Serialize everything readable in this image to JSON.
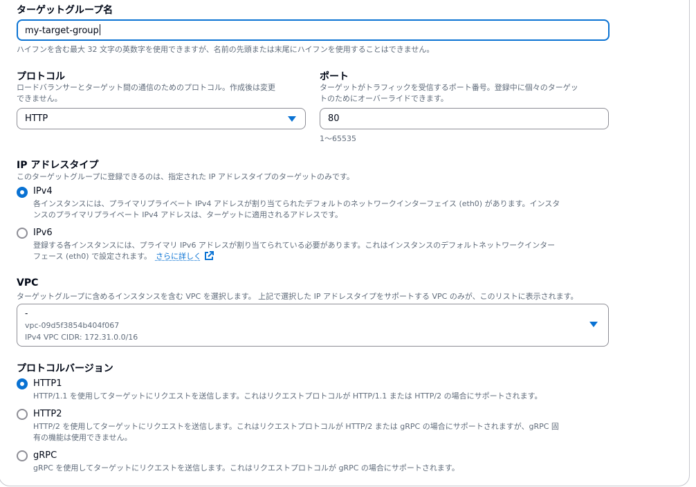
{
  "target_group_name": {
    "label": "ターゲットグループ名",
    "value": "my-target-group",
    "hint": "ハイフンを含む最大 32 文字の英数字を使用できますが、名前の先頭または末尾にハイフンを使用することはできません。"
  },
  "protocol": {
    "label": "プロトコル",
    "desc_line1": "ロードバランサーとターゲット間の通信のためのプロトコル。作成後は変更",
    "desc_line2": "できません。",
    "selected": "HTTP"
  },
  "port": {
    "label": "ポート",
    "desc_line1": "ターゲットがトラフィックを受信するポート番号。登録中に個々のターゲッ",
    "desc_line2": "トのためにオーバーライドできます。",
    "value": "80",
    "range_hint": "1〜65535"
  },
  "ip_address_type": {
    "label": "IP アドレスタイプ",
    "desc": "このターゲットグループに登録できるのは、指定された IP アドレスタイプのターゲットのみです。",
    "options": [
      {
        "label": "IPv4",
        "selected": true,
        "desc_line1": "各インスタンスには、プライマリプライベート IPv4 アドレスが割り当てられたデフォルトのネットワークインターフェイス (eth0) があります。インスタ",
        "desc_line2": "ンスのプライマリプライベート IPv4 アドレスは、ターゲットに適用されるアドレスです。"
      },
      {
        "label": "IPv6",
        "selected": false,
        "desc_line1": "登録する各インスタンスには、プライマリ IPv6 アドレスが割り当てられている必要があります。これはインスタンスのデフォルトネットワークインター",
        "desc_line2": "フェース (eth0) で設定されます。",
        "link": "さらに詳しく"
      }
    ]
  },
  "vpc": {
    "label": "VPC",
    "desc": "ターゲットグループに含めるインスタンスを含む VPC を選択します。 上記で選択した IP アドレスタイプをサポートする VPC のみが、このリストに表示されます。",
    "selected_name": "-",
    "selected_id": "vpc-09d5f3854b404f067",
    "selected_cidr": "IPv4 VPC CIDR: 172.31.0.0/16"
  },
  "protocol_version": {
    "label": "プロトコルバージョン",
    "options": [
      {
        "label": "HTTP1",
        "selected": true,
        "desc_line1": "HTTP/1.1 を使用してターゲットにリクエストを送信します。これはリクエストプロトコルが HTTP/1.1 または HTTP/2 の場合にサポートされます。",
        "desc_line2": ""
      },
      {
        "label": "HTTP2",
        "selected": false,
        "desc_line1": "HTTP/2 を使用してターゲットにリクエストを送信します。これはリクエストプロトコルが HTTP/2 または gRPC の場合にサポートされますが、gRPC 固",
        "desc_line2": "有の機能は使用できません。"
      },
      {
        "label": "gRPC",
        "selected": false,
        "desc_line1": "gRPC を使用してターゲットにリクエストを送信します。これはリクエストプロトコルが gRPC の場合にサポートされます。",
        "desc_line2": ""
      }
    ]
  },
  "colors": {
    "accent": "#0972d3",
    "text": "#000716",
    "secondary_text": "#5f6b7a",
    "border": "#8c8c94"
  }
}
